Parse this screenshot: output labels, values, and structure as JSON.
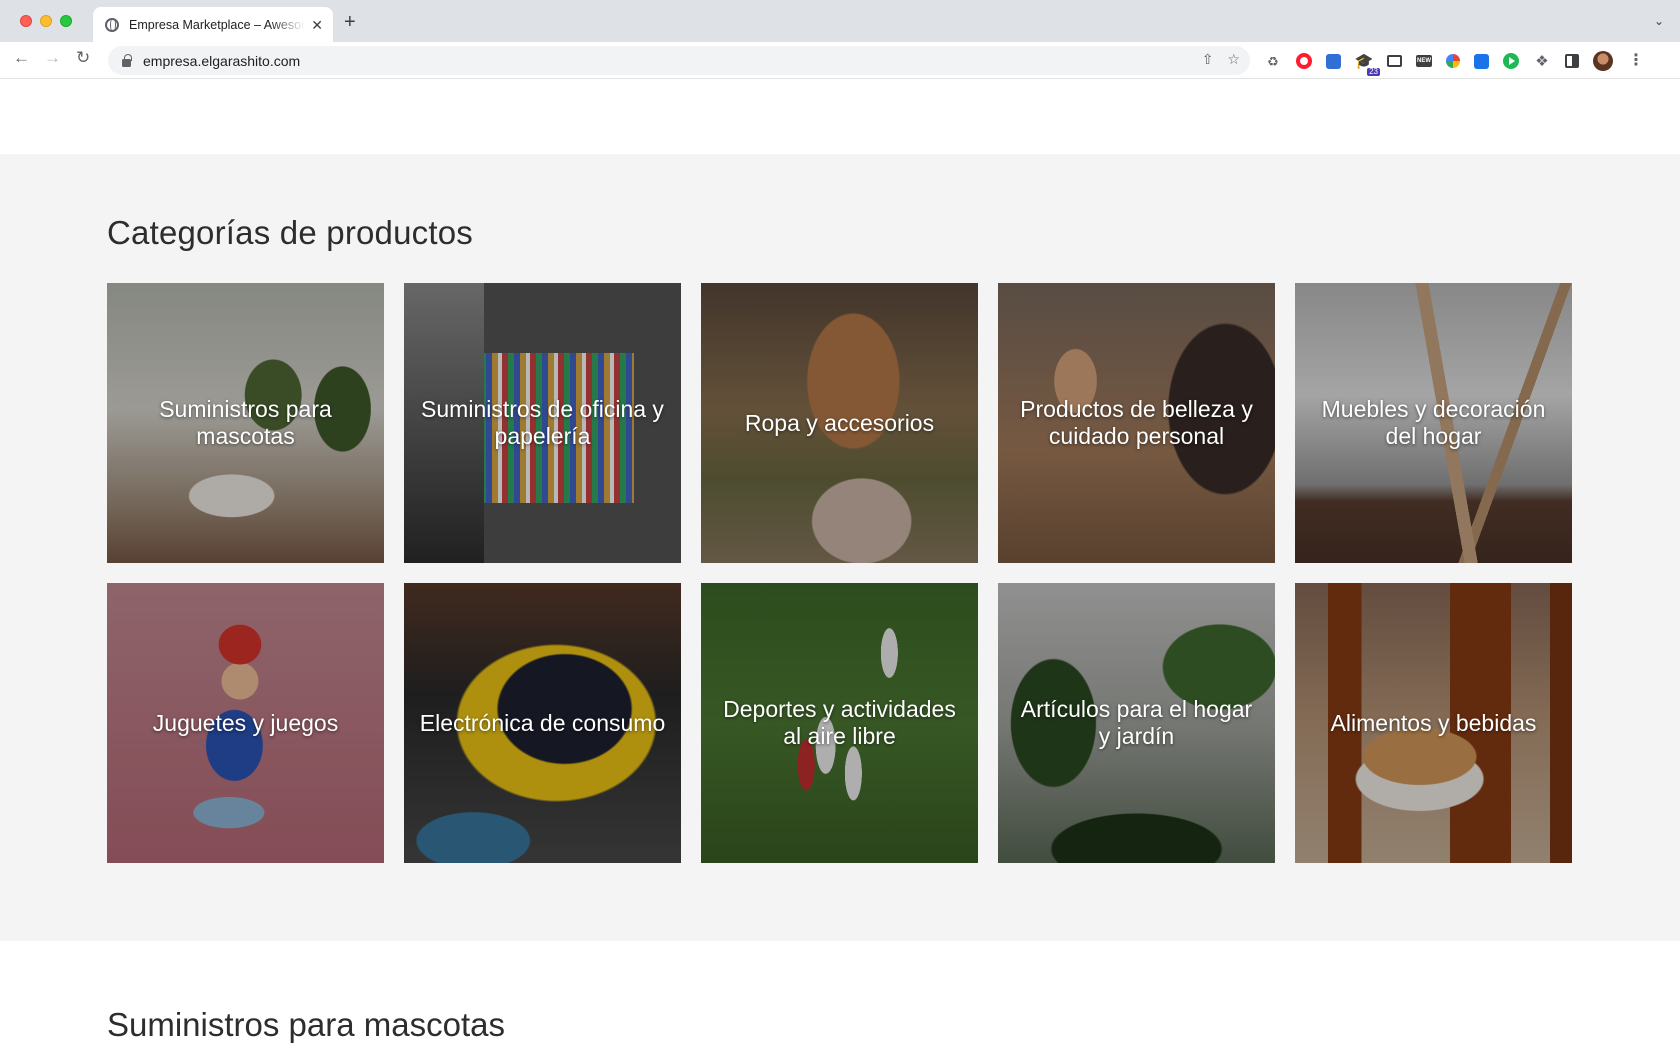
{
  "browser": {
    "tab_title": "Empresa Marketplace – Awesome",
    "url": "empresa.elgarashito.com",
    "new_tab_glyph": "+",
    "tab_close_glyph": "✕",
    "extension_badge": "23",
    "extension_new_label": "NEW"
  },
  "page": {
    "section_title": "Categorías de productos",
    "categories": [
      {
        "label": "Suministros para mascotas",
        "image": "pets"
      },
      {
        "label": "Suministros de oficina y papelería",
        "image": "office"
      },
      {
        "label": "Ropa y accesorios",
        "image": "clothes"
      },
      {
        "label": "Productos de belleza y cuidado personal",
        "image": "beauty"
      },
      {
        "label": "Muebles y decoración del hogar",
        "image": "furniture"
      },
      {
        "label": "Juguetes y juegos",
        "image": "toys"
      },
      {
        "label": "Electrónica de consumo",
        "image": "electronics"
      },
      {
        "label": "Deportes y actividades al aire libre",
        "image": "sports"
      },
      {
        "label": "Artículos para el hogar y jardín",
        "image": "garden"
      },
      {
        "label": "Alimentos y bebidas",
        "image": "food"
      }
    ],
    "next_section_title": "Suministros para mascotas"
  }
}
